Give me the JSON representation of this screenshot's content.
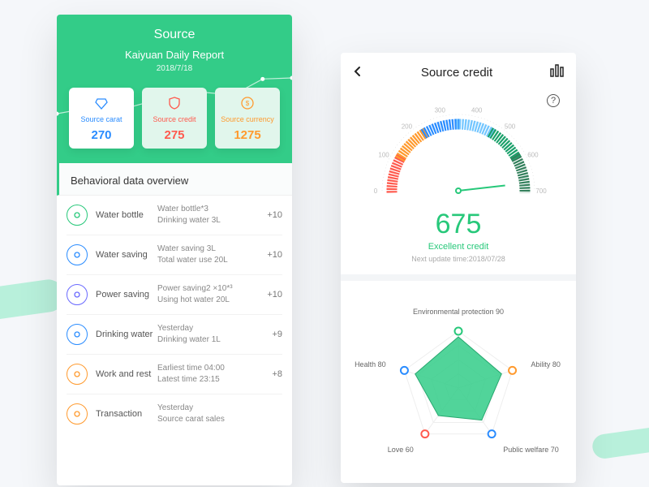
{
  "left": {
    "hero": {
      "title": "Source",
      "subtitle": "Kaiyuan Daily Report",
      "date": "2018/7/18",
      "sparkline": [
        15,
        25,
        20,
        35,
        30,
        55,
        50,
        80,
        82
      ],
      "cards": [
        {
          "icon": "diamond",
          "label": "Source carat",
          "value": "270",
          "cls": "blue"
        },
        {
          "icon": "shield",
          "label": "Source credit",
          "value": "275",
          "cls": "red",
          "dim": true
        },
        {
          "icon": "coin",
          "label": "Source currency",
          "value": "1275",
          "cls": "orange",
          "dim": true
        }
      ]
    },
    "section_title": "Behavioral data overview",
    "items": [
      {
        "color": "#27c87a",
        "name": "Water bottle",
        "l1": "Water bottle*3",
        "l2": "Drinking water 3L",
        "delta": "+10"
      },
      {
        "color": "#2a8cff",
        "name": "Water saving",
        "l1": "Water saving 3L",
        "l2": "Total water use 20L",
        "delta": "+10"
      },
      {
        "color": "#6a6aff",
        "name": "Power saving",
        "l1": "Power saving2 ×10*³",
        "l2": "Using hot water 20L",
        "delta": "+10"
      },
      {
        "color": "#2a8cff",
        "name": "Drinking water",
        "l1": "Yesterday",
        "l2": "Drinking water  1L",
        "delta": "+9"
      },
      {
        "color": "#ff9a2e",
        "name": "Work and rest",
        "l1": "Earliest time 04:00",
        "l2": "Latest time  23:15",
        "delta": "+8"
      },
      {
        "color": "#ff9a2e",
        "name": "Transaction",
        "l1": "Yesterday",
        "l2": "Source carat sales",
        "delta": ""
      }
    ]
  },
  "right": {
    "title": "Source credit",
    "gauge": {
      "ticks": [
        "0",
        "100",
        "200",
        "300",
        "400",
        "500",
        "600",
        "700"
      ],
      "colors": [
        "#ff5a4e",
        "#ff9a2e",
        "#2a8cff",
        "#73c6ff",
        "#1aa06a",
        "#33805c"
      ],
      "score": "675",
      "score_label": "Excellent credit",
      "next_update": "Next update time:2018/07/28"
    },
    "radar": {
      "axes": [
        {
          "label": "Environmental protection 90",
          "value": 90
        },
        {
          "label": "Ability 80",
          "value": 80
        },
        {
          "label": "Public welfare 70",
          "value": 70
        },
        {
          "label": "Love 60",
          "value": 60
        },
        {
          "label": "Health 80",
          "value": 80
        }
      ],
      "dot_colors": [
        "#27c87a",
        "#ff9a2e",
        "#2a8cff",
        "#ff5a4e",
        "#2a8cff"
      ]
    }
  },
  "chart_data": [
    {
      "type": "line",
      "title": "Kaiyuan Daily Report sparkline",
      "x": [
        1,
        2,
        3,
        4,
        5,
        6,
        7,
        8,
        9
      ],
      "values": [
        15,
        25,
        20,
        35,
        30,
        55,
        50,
        80,
        82
      ]
    },
    {
      "type": "bar",
      "title": "Source credit gauge",
      "categories": [
        "score"
      ],
      "values": [
        675
      ],
      "ylim": [
        0,
        700
      ]
    },
    {
      "type": "other",
      "title": "Source credit radar",
      "categories": [
        "Environmental protection",
        "Ability",
        "Public welfare",
        "Love",
        "Health"
      ],
      "values": [
        90,
        80,
        70,
        60,
        80
      ],
      "ylim": [
        0,
        100
      ]
    }
  ]
}
